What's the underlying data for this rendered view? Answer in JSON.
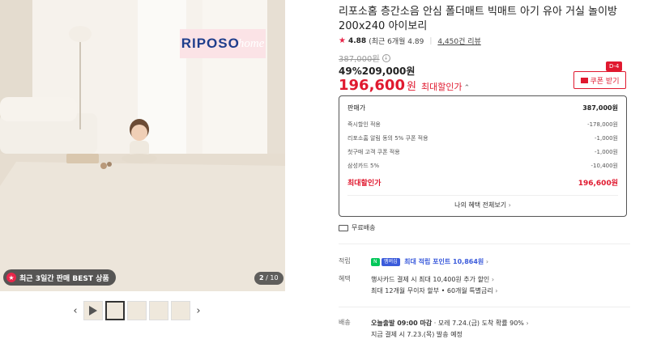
{
  "gallery": {
    "brand_logo_main": "RIPOSO",
    "brand_logo_script": "home",
    "best_badge": "최근 3일간 판매 BEST 상품",
    "page_current": "2",
    "page_total": "/ 10",
    "thumbnails": [
      "video",
      "image-1",
      "image-2",
      "image-3",
      "image-4"
    ]
  },
  "product": {
    "title": "리포소홈 층간소음 안심 폴더매트 빅매트 아기 유아 거실 놀이방 200x240 아이보리",
    "rating": "4.88",
    "rating_detail": "(최근 6개월 4.89",
    "reviews": "4,450건 리뷰",
    "original_price": "387,000원",
    "discount_rate": "49%",
    "sale_price": "209,000원",
    "final_price": "196,600",
    "final_won": "원",
    "final_label": "최대할인가",
    "coupon_badge": "D-4",
    "coupon_button": "쿠폰 받기"
  },
  "price_box": {
    "header": {
      "label": "판매가",
      "value": "387,000원"
    },
    "rows": [
      {
        "label": "즉시할인 적용",
        "value": "-178,000원"
      },
      {
        "label": "리포소홈 알림 동의 5% 쿠폰 적용",
        "value": "-1,000원"
      },
      {
        "label": "첫구매 고객 쿠폰 적용",
        "value": "-1,000원"
      },
      {
        "label": "삼성카드 5%",
        "value": "-10,400원"
      }
    ],
    "total": {
      "label": "최대할인가",
      "value": "196,600원"
    },
    "benefit_link": "나의 혜택 전체보기"
  },
  "shipping_free": "무료배송",
  "details": {
    "point_label": "적립",
    "point_badge": "N",
    "point_badge2": "멤버십",
    "point_text": "최대 적립 포인트 10,864원",
    "benefit_label": "혜택",
    "benefit_line1": "행사카드 결제 시 최대 10,400원 추가 할인",
    "benefit_line2": "최대 12개월 무이자 할부 • 60개월 특별금리",
    "delivery_label": "배송",
    "delivery_line1_bold": "오늘출발 09:00 마감",
    "delivery_line1_rest": "· 모레 7.24.(금) 도착 확률 90%",
    "delivery_line2": "지금 결제 시 7.23.(목) 발송 예정"
  },
  "colors": {
    "accent_red": "#e0192f",
    "point_blue": "#3b5bdb",
    "npay_green": "#03c75a"
  }
}
